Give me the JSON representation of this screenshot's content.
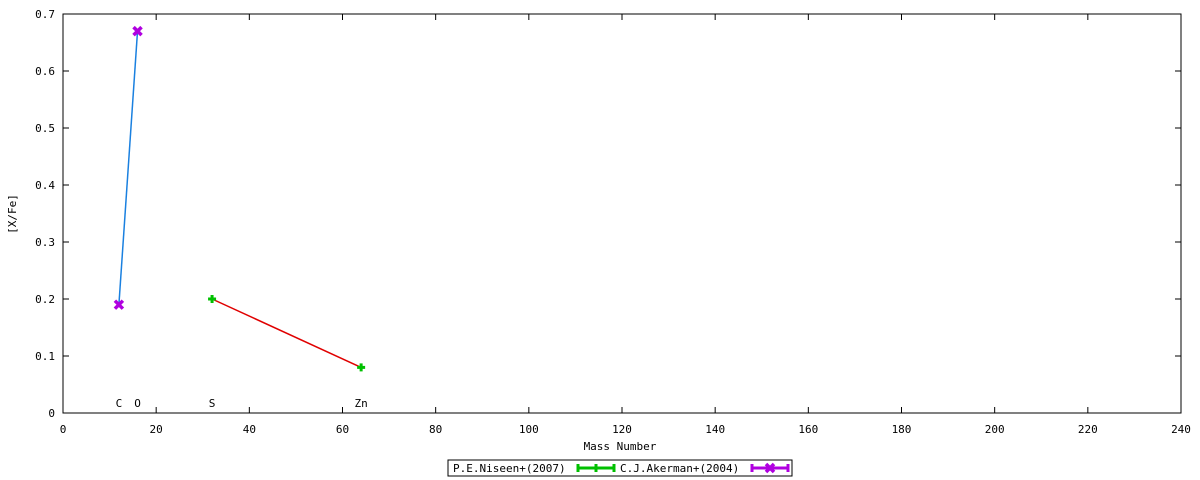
{
  "chart_data": {
    "type": "scatter",
    "xlabel": "Mass Number",
    "ylabel": "[X/Fe]",
    "xlim": [
      0,
      240
    ],
    "ylim": [
      0,
      0.7
    ],
    "xticks": [
      0,
      20,
      40,
      60,
      80,
      100,
      120,
      140,
      160,
      180,
      200,
      220,
      240
    ],
    "yticks": [
      0,
      0.1,
      0.2,
      0.3,
      0.4,
      0.5,
      0.6,
      0.7
    ],
    "xtick_labels": [
      "0",
      "20",
      "40",
      "60",
      "80",
      "100",
      "120",
      "140",
      "160",
      "180",
      "200",
      "220",
      "240"
    ],
    "ytick_labels": [
      "0",
      "0.1",
      "0.2",
      "0.3",
      "0.4",
      "0.5",
      "0.6",
      "0.7"
    ],
    "grid": false,
    "legend_position": "bottom-center",
    "element_labels": [
      {
        "text": "C",
        "x": 12
      },
      {
        "text": "O",
        "x": 16
      },
      {
        "text": "S",
        "x": 32
      },
      {
        "text": "Zn",
        "x": 64
      }
    ],
    "series": [
      {
        "name": "P.E.Niseen+(2007)",
        "marker": "plus",
        "marker_color": "#00c000",
        "line_color": "#e00000",
        "x": [
          32,
          64
        ],
        "y": [
          0.2,
          0.08
        ]
      },
      {
        "name": "C.J.Akerman+(2004)",
        "marker": "cross",
        "marker_color": "#b000e0",
        "line_color": "#1a80e0",
        "x": [
          12,
          16
        ],
        "y": [
          0.19,
          0.67
        ]
      }
    ]
  }
}
